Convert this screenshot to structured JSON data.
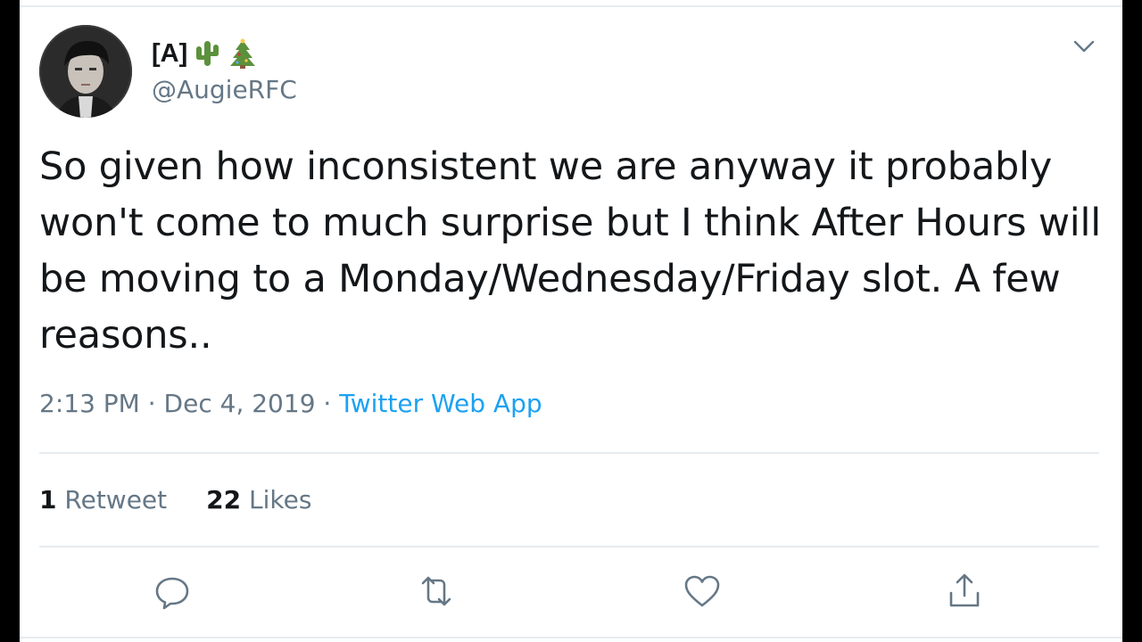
{
  "user": {
    "display_name": "[A]",
    "handle": "@AugieRFC",
    "name_emojis": [
      "cactus-emoji",
      "christmas-tree-emoji"
    ]
  },
  "tweet": {
    "text": "So given how inconsistent we are anyway it probably won't come to much surprise but I think After Hours will be moving to a Monday/Wednesday/Friday slot. A few reasons..",
    "time": "2:13 PM",
    "date": "Dec 4, 2019",
    "separator": "·",
    "source": "Twitter Web App"
  },
  "stats": {
    "retweets_count": "1",
    "retweets_label": "Retweet",
    "likes_count": "22",
    "likes_label": "Likes"
  },
  "actions": [
    "reply-icon",
    "retweet-icon",
    "like-icon",
    "share-icon"
  ],
  "colors": {
    "text": "#14171a",
    "secondary": "#657786",
    "link": "#1da1f2",
    "divider": "#e6ecf0",
    "background": "#000000"
  }
}
